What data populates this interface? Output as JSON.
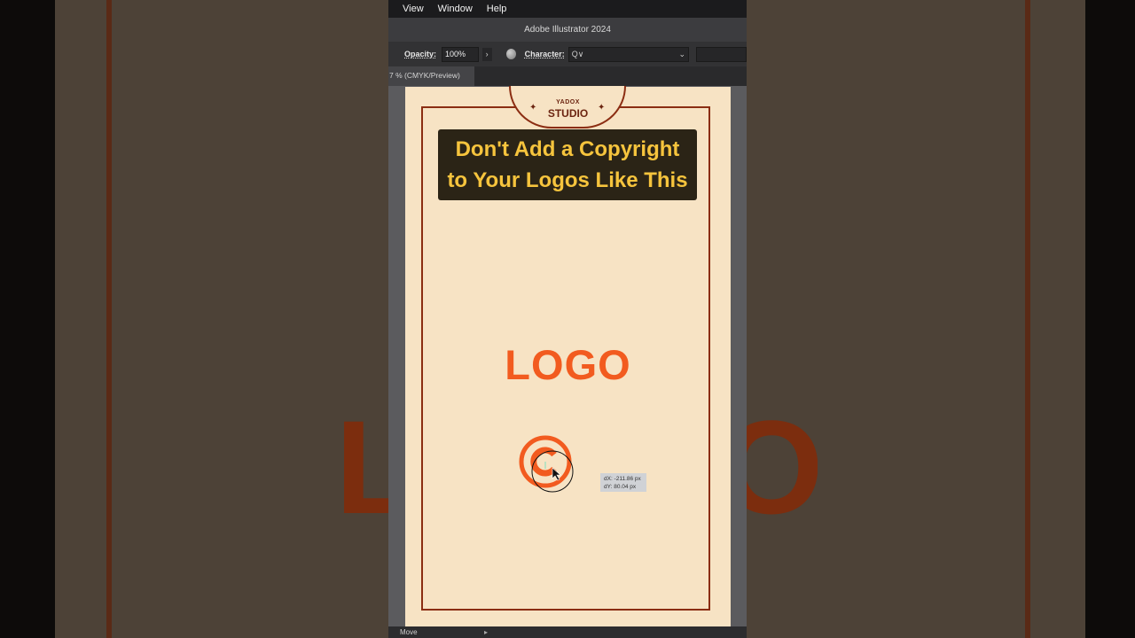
{
  "menubar": {
    "items": [
      "View",
      "Window",
      "Help"
    ]
  },
  "window": {
    "title": "Adobe Illustrator 2024"
  },
  "control_bar": {
    "opacity_label": "Opacity:",
    "opacity_value": "100%",
    "arrow": "›",
    "character_label": "Character:",
    "character_value": "Q∨"
  },
  "document_tab": {
    "label": "7 % (CMYK/Preview)"
  },
  "artboard": {
    "studio_top": "YADOX",
    "studio_name": "STUDIO",
    "sparkle": "✦",
    "headline_line1": "Don't Add a Copyright",
    "headline_line2": "to Your Logos Like This",
    "logo_text": "LOGO"
  },
  "tooltip": {
    "dx": "dX: -211.86 px",
    "dy": "dY: 80.04 px"
  },
  "status_bar": {
    "tool": "Move",
    "arrow": "▸"
  },
  "background": {
    "logo_left": "LO",
    "logo_right": "O"
  },
  "colors": {
    "artboard_bg": "#f7e3c4",
    "frame": "#8b2d12",
    "headline_bg": "#2b2416",
    "headline_text": "#f6c43d",
    "logo_orange": "#f25b1f"
  }
}
